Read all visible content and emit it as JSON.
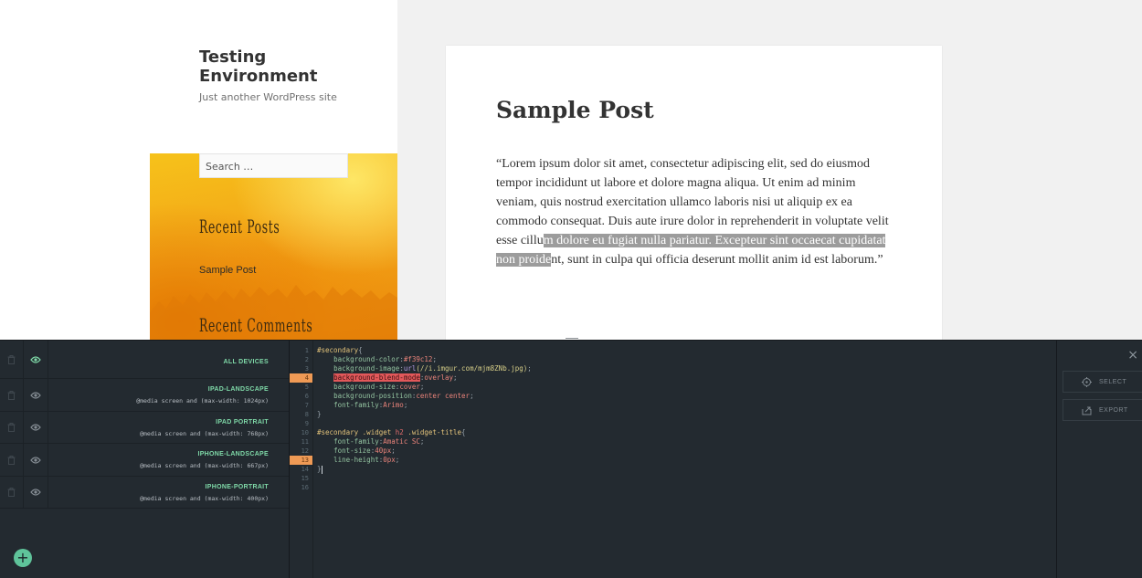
{
  "site": {
    "title": "Testing Environment",
    "description": "Just another WordPress site",
    "search_placeholder": "Search …",
    "widgets": {
      "recent_posts_title": "Recent Posts",
      "recent_posts_item": "Sample Post",
      "recent_comments_title": "Recent Comments"
    }
  },
  "post": {
    "title": "Sample Post",
    "body_before": "“Lorem ipsum dolor sit amet, consectetur adipiscing elit, sed do eiusmod tempor incididunt ut labore et dolore magna aliqua. Ut enim ad minim veniam, quis nostrud exercitation ullamco laboris nisi ut aliquip ex ea commodo consequat. Duis aute irure dolor in reprehenderit in voluptate velit esse cillu",
    "body_selected": "m dolore eu fugiat nulla pariatur. Excepteur sint occaecat cupidatat non proide",
    "body_after": "nt, sunt in culpa qui officia deserunt mollit anim id est laborum.”"
  },
  "devices": [
    {
      "name": "ALL DEVICES",
      "media": ""
    },
    {
      "name": "IPAD-LANDSCAPE",
      "media": "@media screen and (max-width: 1024px)"
    },
    {
      "name": "IPAD PORTRAIT",
      "media": "@media screen and (max-width: 768px)"
    },
    {
      "name": "IPHONE-LANDSCAPE",
      "media": "@media screen and (max-width: 667px)"
    },
    {
      "name": "IPHONE-PORTRAIT",
      "media": "@media screen and (max-width: 400px)"
    }
  ],
  "add_button": "+",
  "code": {
    "line_numbers": [
      "1",
      "2",
      "3",
      "4",
      "5",
      "6",
      "7",
      "8",
      "9",
      "10",
      "11",
      "12",
      "13",
      "14",
      "15",
      "16"
    ],
    "highlighted_lines": [
      4,
      13
    ],
    "lines": [
      {
        "sel": "#secondary",
        "rest": "{"
      },
      {
        "prop": "background-color",
        "val": "#f39c12",
        "end": ";"
      },
      {
        "prop": "background-image",
        "val": "url",
        "str": "(//i.imgur.com/mjm8ZNb.jpg)",
        "end": ";"
      },
      {
        "prop": "background-blend-mode",
        "val": "overlay",
        "end": ";"
      },
      {
        "prop": "background-size",
        "val": "cover",
        "end": ";"
      },
      {
        "prop": "background-position",
        "val": "center center",
        "end": ";"
      },
      {
        "prop": "font-family",
        "val": "Arimo",
        "end": ";"
      },
      {
        "text": "}"
      },
      {
        "text": ""
      },
      {
        "sel": "#secondary .widget",
        "kw": "h2",
        "sel2": ".widget-title",
        "rest": "{"
      },
      {
        "prop": "font-family",
        "val": "Amatic SC",
        "end": ";"
      },
      {
        "prop": "font-size",
        "val": "40px",
        "end": ";"
      },
      {
        "prop": "line-height",
        "val": "0px",
        "end": ";"
      },
      {
        "text": "}"
      },
      {
        "text": ""
      },
      {
        "text": ""
      }
    ]
  },
  "side_buttons": {
    "select": "SELECT",
    "export": "EXPORT",
    "close": "×"
  },
  "colors": {
    "accent": "#5fc39a",
    "widget_bg": "#f39c12",
    "editor_bg": "#232a30"
  }
}
